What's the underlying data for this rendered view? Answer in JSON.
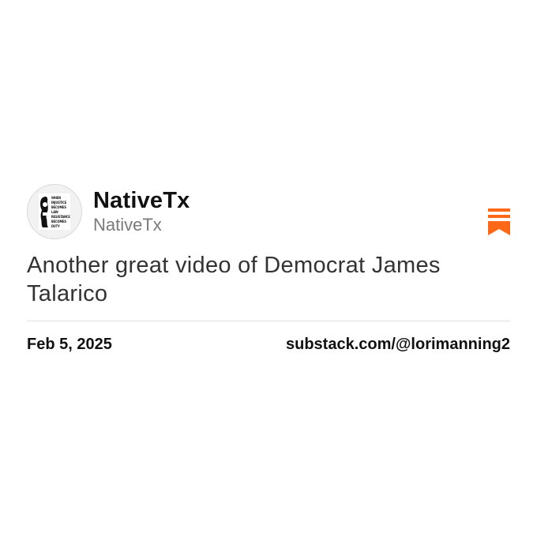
{
  "post": {
    "display_name": "NativeTx",
    "handle": "NativeTx",
    "text": "Another great video of Democrat James Talarico",
    "date": "Feb 5, 2025",
    "source": "substack.com/@lorimanning2"
  },
  "avatar": {
    "lines": [
      "WHEN",
      "INJUSTICE",
      "BECOMES",
      "LAW",
      "RESISTANCE",
      "BECOMES",
      "DUTY"
    ]
  },
  "icons": {
    "bookmark": "substack-bookmark-icon"
  },
  "colors": {
    "accent": "#FF6719",
    "text": "#111111",
    "muted": "#7a7a7a"
  }
}
